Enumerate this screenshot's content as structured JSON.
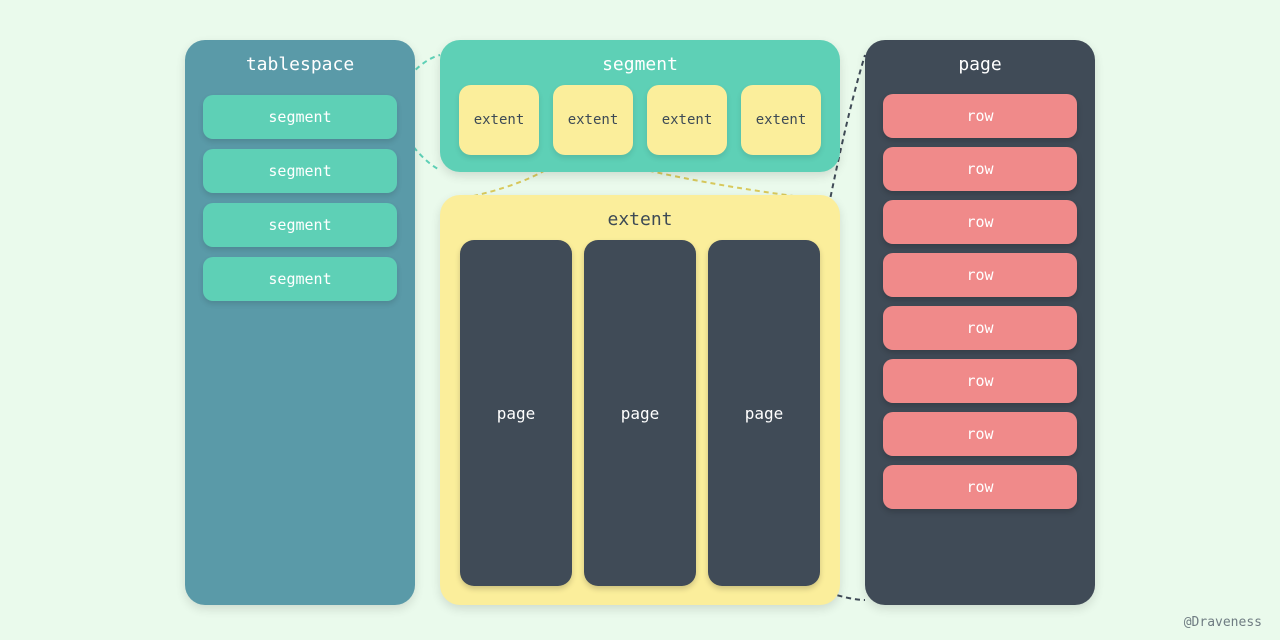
{
  "tablespace": {
    "title": "tablespace",
    "items": [
      "segment",
      "segment",
      "segment",
      "segment"
    ]
  },
  "segment": {
    "title": "segment",
    "items": [
      "extent",
      "extent",
      "extent",
      "extent"
    ]
  },
  "extent": {
    "title": "extent",
    "items": [
      "page",
      "page",
      "page"
    ]
  },
  "page": {
    "title": "page",
    "items": [
      "row",
      "row",
      "row",
      "row",
      "row",
      "row",
      "row",
      "row"
    ]
  },
  "credit": "@Draveness",
  "colors": {
    "background": "#eafaec",
    "tablespace": "#5a9aa8",
    "segment": "#5ed0b6",
    "extent": "#fbee9b",
    "page_box": "#404b57",
    "row_box": "#f08a8a"
  }
}
